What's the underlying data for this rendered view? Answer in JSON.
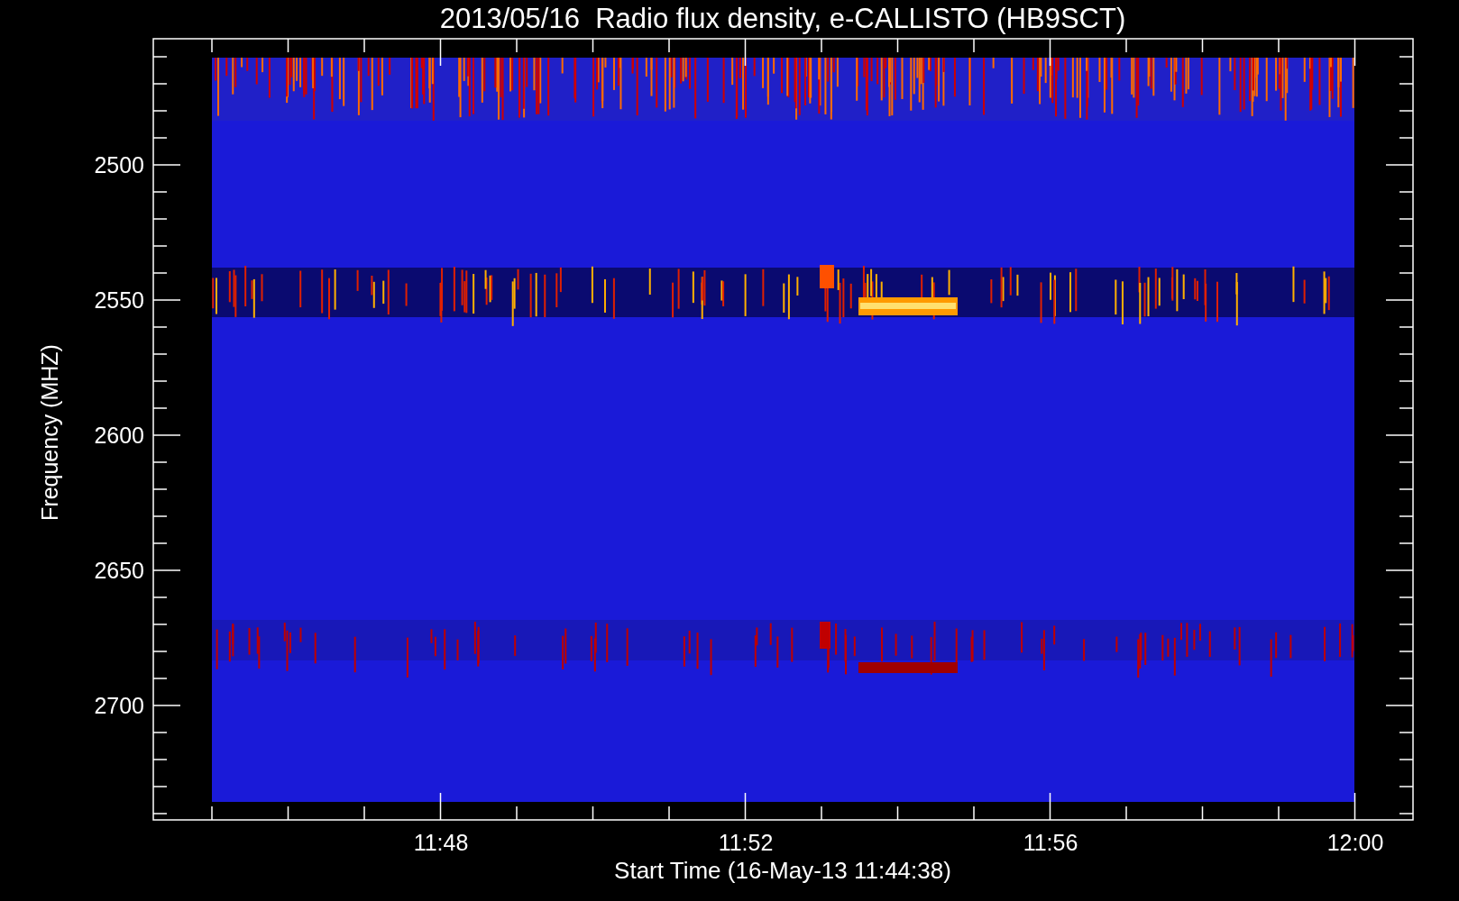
{
  "title": "2013/05/16  Radio flux density, e-CALLISTO (HB9SCT)",
  "plot": {
    "ylabel": "Frequency (MHZ)",
    "xlabel": "Start Time (16-May-13 11:44:38)",
    "yticks": [
      "2500",
      "2550",
      "2600",
      "2650",
      "2700"
    ],
    "xticks": [
      "11:48",
      "11:52",
      "11:56",
      "12:00"
    ]
  }
}
